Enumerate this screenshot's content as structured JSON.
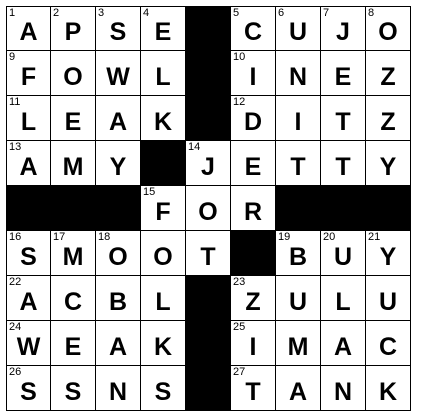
{
  "puzzle": {
    "rows": 9,
    "cols": 9,
    "grid": [
      [
        "A",
        "P",
        "S",
        "E",
        "#",
        "C",
        "U",
        "J",
        "O"
      ],
      [
        "F",
        "O",
        "W",
        "L",
        "#",
        "I",
        "N",
        "E",
        "Z"
      ],
      [
        "L",
        "E",
        "A",
        "K",
        "#",
        "D",
        "I",
        "T",
        "Z"
      ],
      [
        "A",
        "M",
        "Y",
        "#",
        "J",
        "E",
        "T",
        "T",
        "Y"
      ],
      [
        "#",
        "#",
        "#",
        "F",
        "O",
        "R",
        "#",
        "#",
        "#"
      ],
      [
        "S",
        "M",
        "O",
        "O",
        "T",
        "#",
        "B",
        "U",
        "Y"
      ],
      [
        "A",
        "C",
        "B",
        "L",
        "#",
        "Z",
        "U",
        "L",
        "U"
      ],
      [
        "W",
        "E",
        "A",
        "K",
        "#",
        "I",
        "M",
        "A",
        "C"
      ],
      [
        "S",
        "S",
        "N",
        "S",
        "#",
        "T",
        "A",
        "N",
        "K"
      ]
    ],
    "numbers": [
      [
        "1",
        "2",
        "3",
        "4",
        "",
        "5",
        "6",
        "7",
        "8"
      ],
      [
        "9",
        "",
        "",
        "",
        "",
        "10",
        "",
        "",
        ""
      ],
      [
        "11",
        "",
        "",
        "",
        "",
        "12",
        "",
        "",
        ""
      ],
      [
        "13",
        "",
        "",
        "",
        "14",
        "",
        "",
        "",
        ""
      ],
      [
        "",
        "",
        "",
        "15",
        "",
        "",
        "",
        "",
        ""
      ],
      [
        "16",
        "17",
        "18",
        "",
        "",
        "",
        "19",
        "20",
        "21"
      ],
      [
        "22",
        "",
        "",
        "",
        "",
        "23",
        "",
        "",
        ""
      ],
      [
        "24",
        "",
        "",
        "",
        "",
        "25",
        "",
        "",
        ""
      ],
      [
        "26",
        "",
        "",
        "",
        "",
        "27",
        "",
        "",
        ""
      ]
    ]
  },
  "colors": {
    "block": "#000000",
    "cell": "#ffffff",
    "ink": "#000000"
  }
}
